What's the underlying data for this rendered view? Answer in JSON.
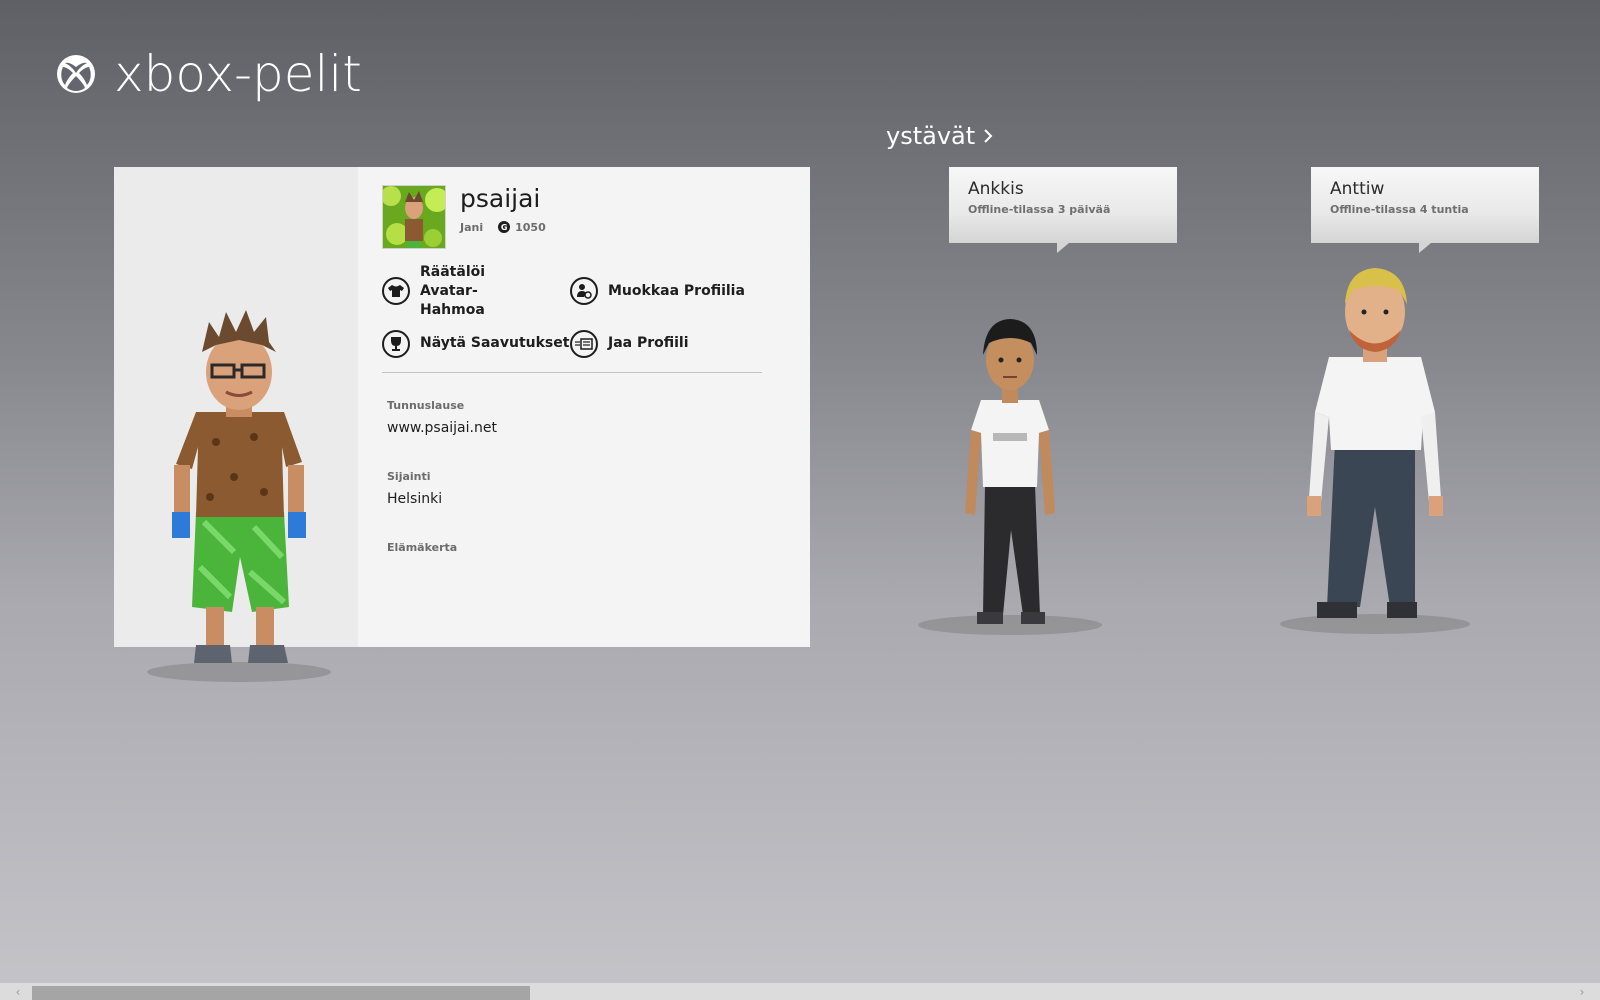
{
  "app": {
    "title": "xbox-pelit",
    "logo_icon": "xbox-logo-icon"
  },
  "profile": {
    "gamertag": "psaijai",
    "real_name": "Jani",
    "gamerscore": "1050",
    "gamerscore_icon": "G",
    "actions": [
      {
        "label": "Räätälöi Avatar-Hahmoa",
        "icon": "shirt-icon"
      },
      {
        "label": "Muokkaa Profiilia",
        "icon": "edit-profile-icon"
      },
      {
        "label": "Näytä Saavutukset",
        "icon": "trophy-icon"
      },
      {
        "label": "Jaa Profiili",
        "icon": "share-profile-icon"
      }
    ],
    "motto_label": "Tunnuslause",
    "motto_value": "www.psaijai.net",
    "location_label": "Sijainti",
    "location_value": "Helsinki",
    "bio_label": "Elämäkerta"
  },
  "friends": {
    "header": "ystävät",
    "items": [
      {
        "name": "Ankkis",
        "status": "Offline-tilassa 3 päivää"
      },
      {
        "name": "Anttiw",
        "status": "Offline-tilassa 4 tuntia"
      }
    ]
  },
  "scrollbar": {
    "left_arrow": "‹",
    "right_arrow": "›"
  }
}
